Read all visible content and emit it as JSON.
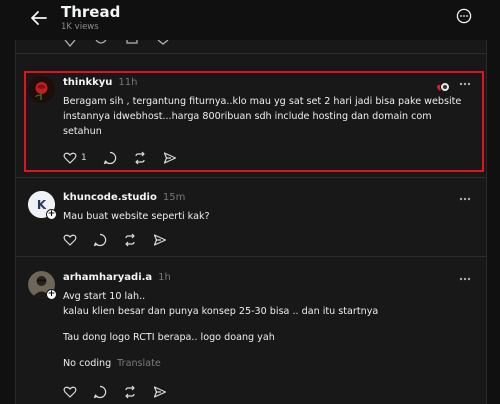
{
  "header": {
    "title": "Thread",
    "views": "1K views"
  },
  "colors": {
    "highlight": "#e0141e",
    "background": "#101010",
    "panel": "#181818"
  },
  "posts": [
    {
      "author": "thinkkyu",
      "time": "11h",
      "text": "Beragam sih , tergantung fiturnya..klo mau yg sat set 2 hari jadi bisa pake website instannya idwebhost...harga 800ribuan sdh include hosting dan domain com setahun",
      "likes": "1"
    },
    {
      "author": "khuncode.studio",
      "time": "15m",
      "text": "Mau buat website seperti kak?"
    },
    {
      "author": "arhamharyadi.a",
      "time": "1h",
      "lines": [
        "Avg start 10 lah..",
        "kalau klien besar dan punya konsep 25-30 bisa .. dan itu startnya",
        "Tau dong logo RCTI berapa.. logo doang yah",
        "No coding"
      ],
      "translate": "Translate"
    }
  ],
  "icons": [
    "back-arrow-icon",
    "more-options-icon",
    "heart-icon",
    "comment-icon",
    "repost-icon",
    "share-icon",
    "follow-plus-icon"
  ]
}
